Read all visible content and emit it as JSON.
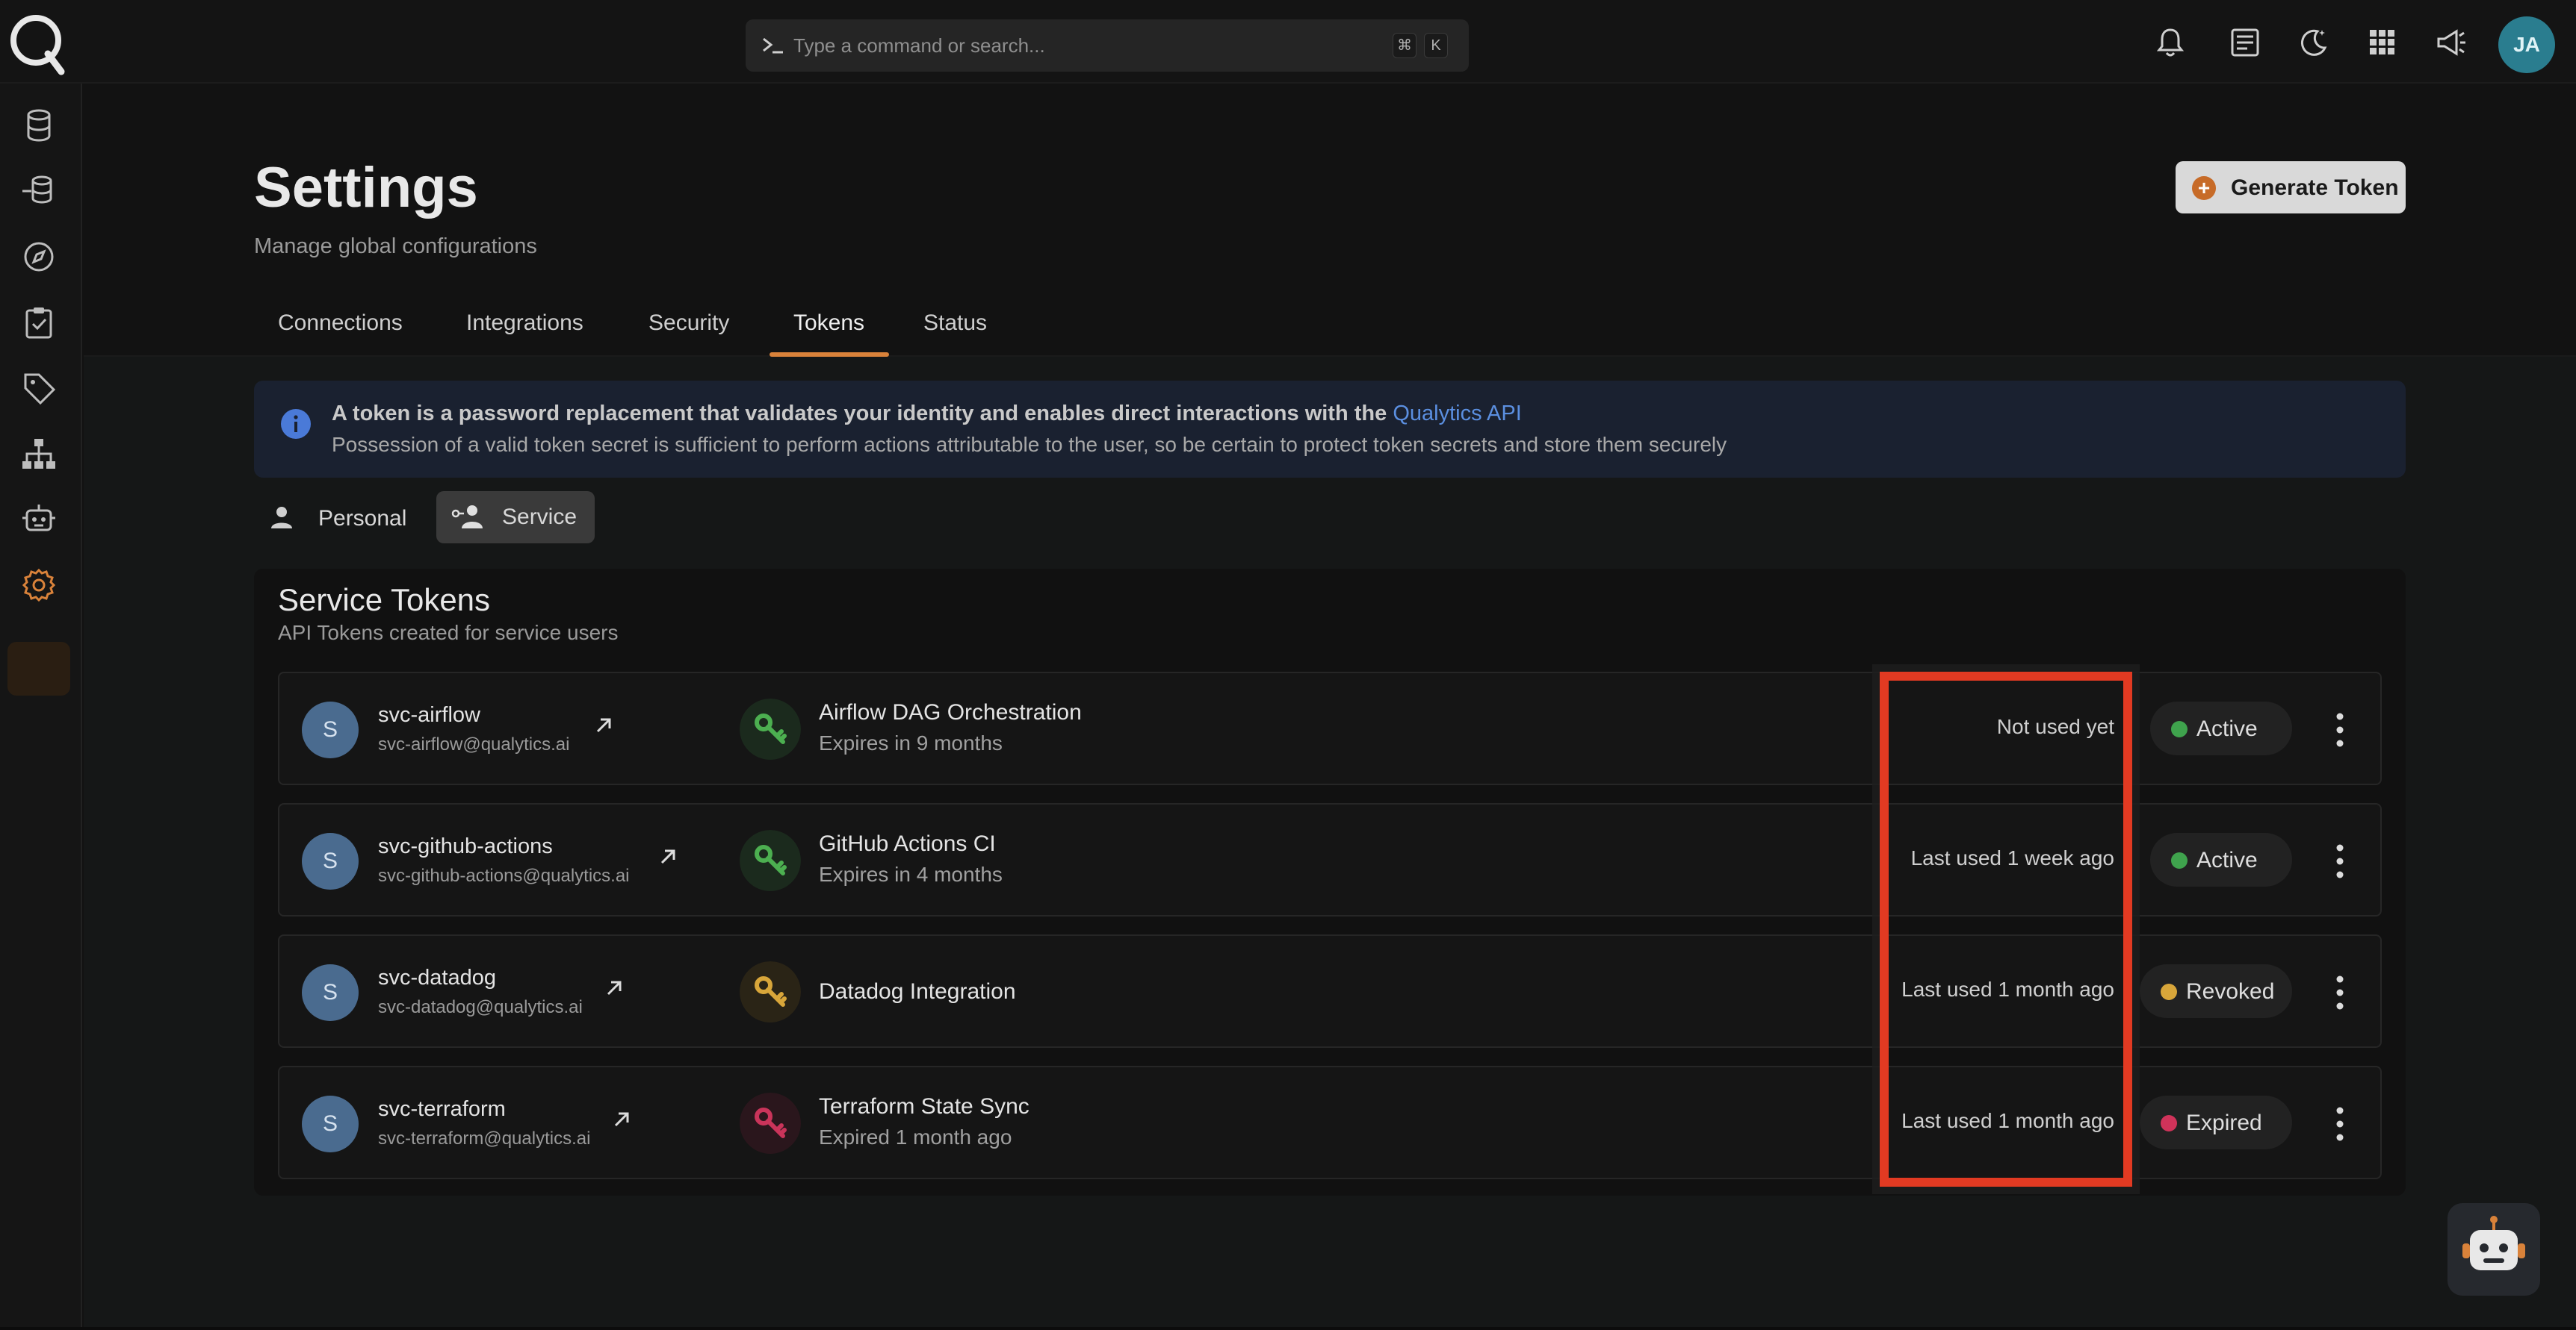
{
  "search": {
    "placeholder": "Type a command or search...",
    "shortcut_mod": "⌘",
    "shortcut_key": "K"
  },
  "user": {
    "initials": "JA"
  },
  "page": {
    "title": "Settings",
    "subtitle": "Manage global configurations",
    "generate_button": "Generate Token"
  },
  "tabs": [
    {
      "label": "Connections"
    },
    {
      "label": "Integrations"
    },
    {
      "label": "Security"
    },
    {
      "label": "Tokens"
    },
    {
      "label": "Status"
    }
  ],
  "info": {
    "line1": "A token is a password replacement that validates your identity and enables direct interactions with the",
    "link": "Qualytics API",
    "line2": "Possession of a valid token secret is sufficient to perform actions attributable to the user, so be certain to protect token secrets and store them securely"
  },
  "toggle": {
    "personal": "Personal",
    "service": "Service"
  },
  "panel": {
    "title": "Service Tokens",
    "subtitle": "API Tokens created for service users"
  },
  "rows": [
    {
      "avatar": "S",
      "user": "svc-airflow",
      "email": "svc-airflow@qualytics.ai",
      "name": "Airflow DAG Orchestration",
      "expiry": "Expires in 9 months",
      "last_used": "Not used yet",
      "status": "Active",
      "status_color": "#3fa34d",
      "key_color": "#4caf50",
      "key_bg": "#1b2a1d"
    },
    {
      "avatar": "S",
      "user": "svc-github-actions",
      "email": "svc-github-actions@qualytics.ai",
      "name": "GitHub Actions CI",
      "expiry": "Expires in 4 months",
      "last_used": "Last used 1 week ago",
      "status": "Active",
      "status_color": "#3fa34d",
      "key_color": "#4caf50",
      "key_bg": "#1b2a1d"
    },
    {
      "avatar": "S",
      "user": "svc-datadog",
      "email": "svc-datadog@qualytics.ai",
      "name": "Datadog Integration",
      "expiry": "",
      "last_used": "Last used 1 month ago",
      "status": "Revoked",
      "status_color": "#d8a63a",
      "key_color": "#d8a63a",
      "key_bg": "#2a2416"
    },
    {
      "avatar": "S",
      "user": "svc-terraform",
      "email": "svc-terraform@qualytics.ai",
      "name": "Terraform State Sync",
      "expiry": "Expired 1 month ago",
      "last_used": "Last used 1 month ago",
      "status": "Expired",
      "status_color": "#d0335a",
      "key_color": "#c9345a",
      "key_bg": "#2a161c"
    }
  ],
  "colors": {
    "accent": "#d9823a",
    "link": "#5b8fe0",
    "highlight": "#e23a22"
  }
}
